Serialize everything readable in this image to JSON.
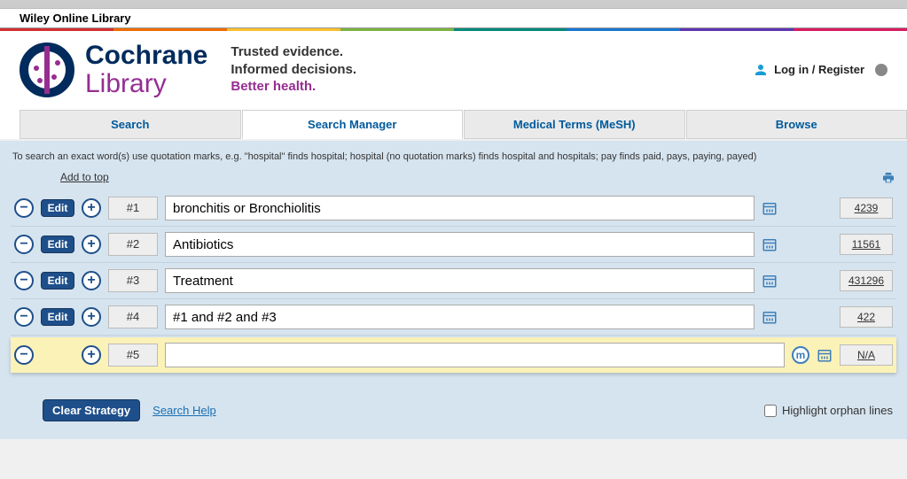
{
  "wiley_label": "Wiley Online Library",
  "accent_colors": [
    "#d32f2f",
    "#ef6c00",
    "#fbc02d",
    "#7cb342",
    "#00897b",
    "#1976d2",
    "#5e35b1",
    "#d81b60"
  ],
  "brand": {
    "line1": "Cochrane",
    "line2": "Library"
  },
  "tagline": {
    "l1": "Trusted evidence.",
    "l2": "Informed decisions.",
    "l3": "Better health."
  },
  "login_label": "Log in / Register",
  "tabs": {
    "search": "Search",
    "search_manager": "Search Manager",
    "mesh": "Medical Terms (MeSH)",
    "browse": "Browse"
  },
  "hint": "To search an exact word(s) use quotation marks, e.g. \"hospital\" finds hospital; hospital (no quotation marks) finds hospital and hospitals; pay finds paid, pays, paying, payed)",
  "add_to_top": "Add to top",
  "edit_label": "Edit",
  "rows": [
    {
      "num": "#1",
      "query": "bronchitis or Bronchiolitis",
      "count": "4239",
      "has_edit": true,
      "active": false
    },
    {
      "num": "#2",
      "query": "Antibiotics",
      "count": "11561",
      "has_edit": true,
      "active": false
    },
    {
      "num": "#3",
      "query": "Treatment",
      "count": "431296",
      "has_edit": true,
      "active": false
    },
    {
      "num": "#4",
      "query": "#1 and #2 and #3",
      "count": "422",
      "has_edit": true,
      "active": false
    },
    {
      "num": "#5",
      "query": "",
      "count": "N/A",
      "has_edit": false,
      "active": true
    }
  ],
  "clear_strategy": "Clear Strategy",
  "search_help": "Search Help",
  "highlight_orphan": "Highlight orphan lines"
}
